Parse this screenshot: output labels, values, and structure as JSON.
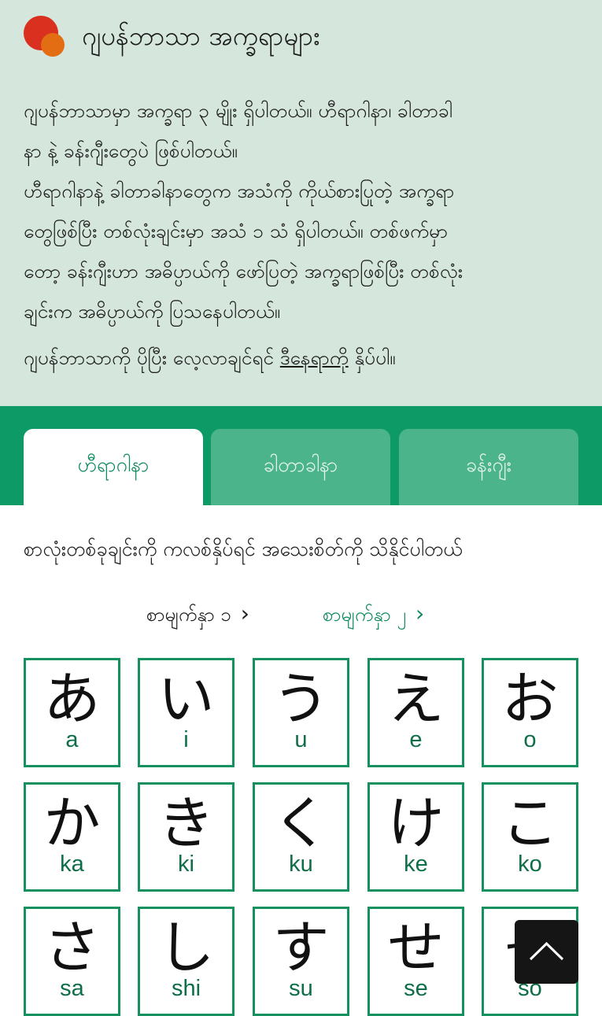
{
  "header": {
    "title": "ဂျပန်ဘာသာ အက္ခရာများ"
  },
  "intro": {
    "paragraph1_line1": "ဂျပန်ဘာသာမှာ အက္ခရာ ၃ မျိုး ရှိပါတယ်။ ဟီရာဂါနာ၊ ခါတာခါ",
    "paragraph1_line2": "နာ နဲ့ ခန်းဂျီးတွေပဲ ဖြစ်ပါတယ်။",
    "paragraph2_line1": "ဟီရာဂါနာနဲ့ ခါတာခါနာတွေက အသံကို ကိုယ်စားပြုတဲ့ အက္ခရာ",
    "paragraph2_line2": "တွေဖြစ်ပြီး တစ်လုံးချင်းမှာ အသံ ၁ သံ ရှိပါတယ်။ တစ်ဖက်မှာ",
    "paragraph2_line3": "တော့ ခန်းဂျီးဟာ အဓိပ္ပာယ်ကို ဖော်ပြတဲ့ အက္ခရာဖြစ်ပြီး တစ်လုံး",
    "paragraph2_line4": "ချင်းက အဓိပ္ပာယ်ကို ပြသနေပါတယ်။",
    "paragraph3_prefix": "ဂျပန်ဘာသာကို ပိုပြီး လေ့လာချင်ရင် ",
    "paragraph3_link": "ဒီနေရာကို",
    "paragraph3_suffix": " နှိပ်ပါ။"
  },
  "tabs": [
    {
      "label": "ဟီရာဂါနာ",
      "active": true
    },
    {
      "label": "ခါတာခါနာ",
      "active": false
    },
    {
      "label": "ခန်းဂျီး",
      "active": false
    }
  ],
  "instruction": "စာလုံးတစ်ခုချင်းကို ကလစ်နှိပ်ရင် အသေးစိတ်ကို သိနိုင်ပါတယ်",
  "pager": {
    "page1_label": "စာမျက်နှာ ၁",
    "page2_label": "စာမျက်နှာ ၂",
    "chevron": "›"
  },
  "kana": [
    {
      "kana": "あ",
      "romaji": "a"
    },
    {
      "kana": "い",
      "romaji": "i"
    },
    {
      "kana": "う",
      "romaji": "u"
    },
    {
      "kana": "え",
      "romaji": "e"
    },
    {
      "kana": "お",
      "romaji": "o"
    },
    {
      "kana": "か",
      "romaji": "ka"
    },
    {
      "kana": "き",
      "romaji": "ki"
    },
    {
      "kana": "く",
      "romaji": "ku"
    },
    {
      "kana": "け",
      "romaji": "ke"
    },
    {
      "kana": "こ",
      "romaji": "ko"
    },
    {
      "kana": "さ",
      "romaji": "sa"
    },
    {
      "kana": "し",
      "romaji": "shi"
    },
    {
      "kana": "す",
      "romaji": "su"
    },
    {
      "kana": "せ",
      "romaji": "se"
    },
    {
      "kana": "そ",
      "romaji": "so"
    }
  ],
  "scroll_top_icon": "chevron-up-icon",
  "colors": {
    "accent_green": "#0e9a66",
    "header_bg": "#d5e6dc",
    "logo_red": "#d9301f",
    "logo_orange": "#e36d12"
  }
}
